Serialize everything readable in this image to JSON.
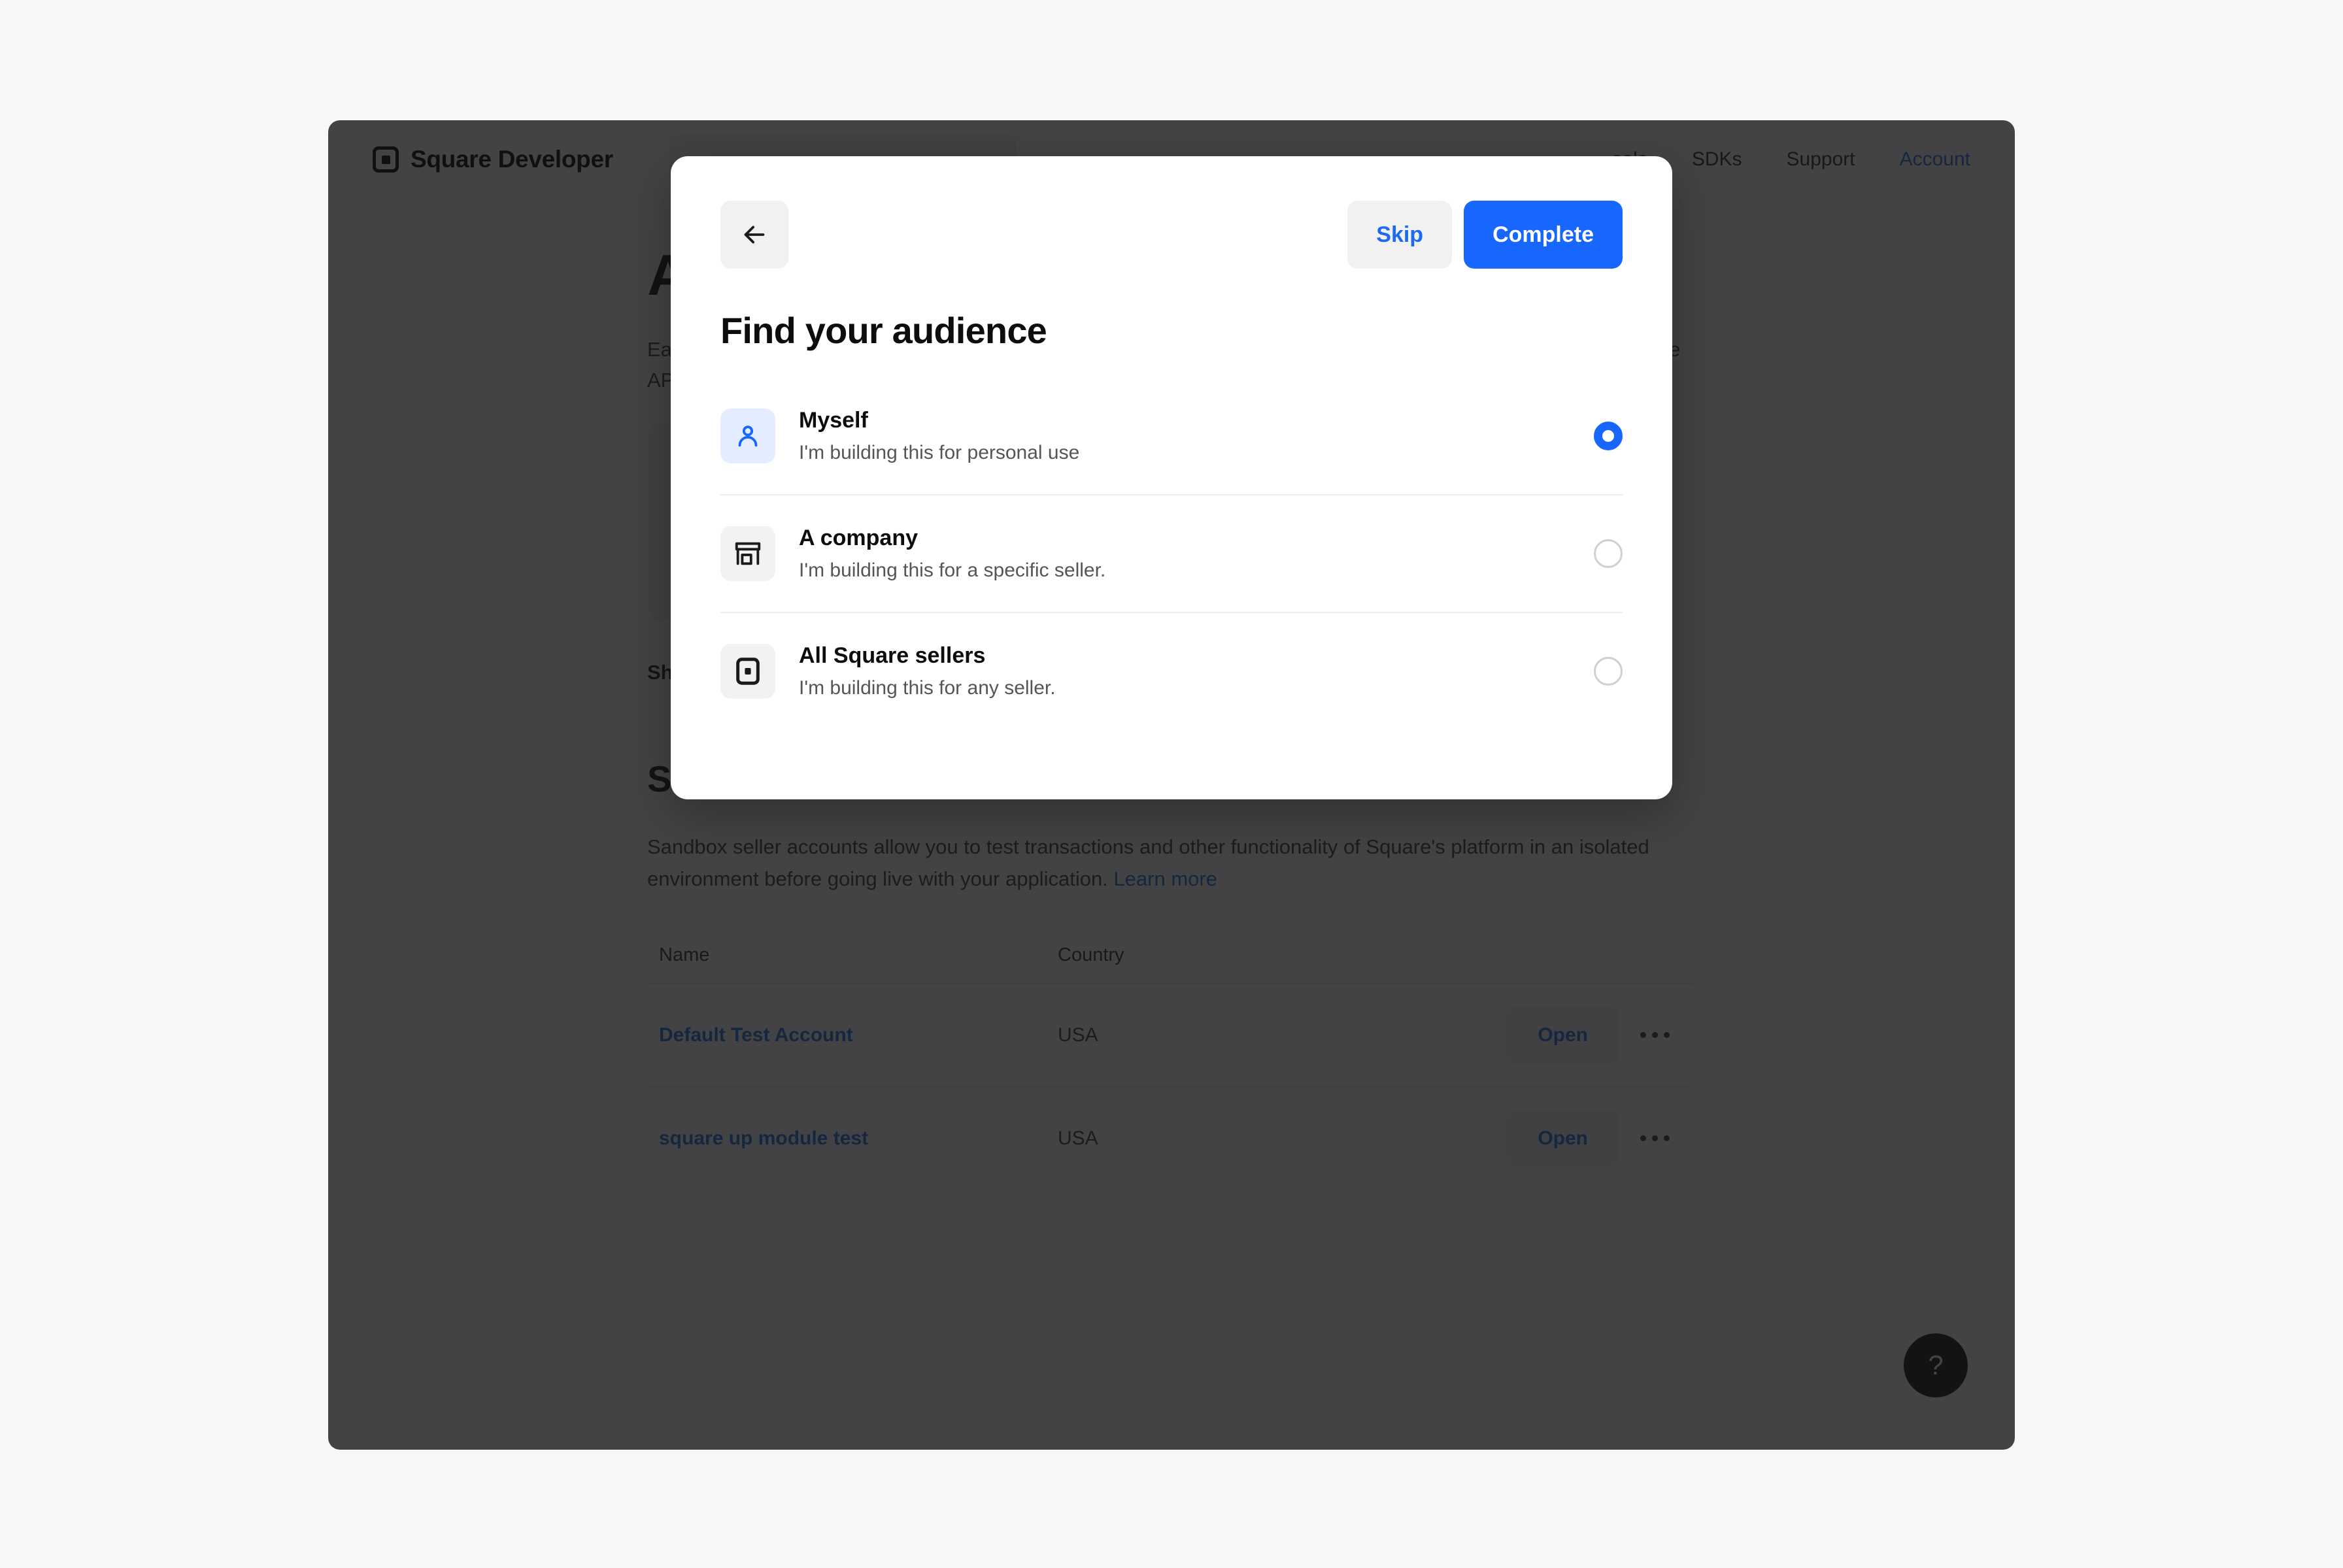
{
  "nav": {
    "brand": "Square Developer",
    "search_placeholder": "",
    "links": [
      {
        "label": "ools",
        "accent": false
      },
      {
        "label": "SDKs",
        "accent": false
      },
      {
        "label": "Support",
        "accent": false
      },
      {
        "label": "Account",
        "accent": true
      }
    ]
  },
  "page": {
    "title": "Applications",
    "intro": "Each application you build can connect to one or more Square sellers. Create an app to get started with the Square APIs.",
    "show_all_apps": "Show all apps",
    "sandbox_title": "Sandbox test accounts",
    "sandbox_desc_before": "Sandbox seller accounts allow you to test transactions and other functionality of Square's platform in an isolated environment before going live with your application. ",
    "sandbox_learn_more": "Learn more",
    "help_label": "?"
  },
  "table": {
    "columns": [
      "Name",
      "Country"
    ],
    "rows": [
      {
        "name": "Default Test Account",
        "country": "USA",
        "action": "Open"
      },
      {
        "name": "square up module test",
        "country": "USA",
        "action": "Open"
      }
    ]
  },
  "modal": {
    "back_label": "back-arrow",
    "skip_label": "Skip",
    "complete_label": "Complete",
    "title": "Find your audience",
    "options": [
      {
        "icon": "person-icon",
        "title": "Myself",
        "subtitle": "I'm building this for personal use",
        "selected": true
      },
      {
        "icon": "storefront-icon",
        "title": "A company",
        "subtitle": "I'm building this for a specific seller.",
        "selected": false
      },
      {
        "icon": "square-logo-icon",
        "title": "All Square sellers",
        "subtitle": "I'm building this for any seller.",
        "selected": false
      }
    ]
  },
  "colors": {
    "accent_blue": "#1767ff",
    "link_blue": "#1f6fe0",
    "overlay": "rgba(20,20,22,0.80)"
  }
}
